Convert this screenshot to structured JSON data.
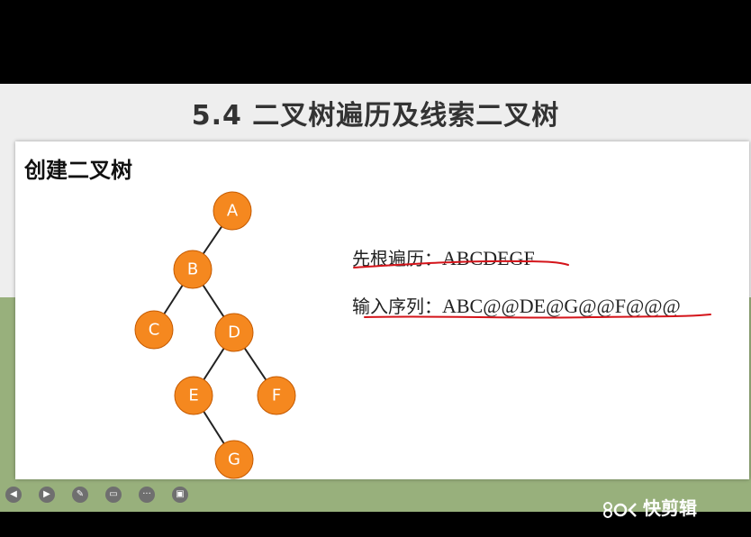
{
  "slide": {
    "title": "5.4 二叉树遍历及线索二叉树",
    "section_heading": "创建二叉树"
  },
  "tree": {
    "nodes": [
      "A",
      "B",
      "C",
      "D",
      "E",
      "F",
      "G"
    ],
    "edges": [
      [
        "A",
        "B"
      ],
      [
        "B",
        "C"
      ],
      [
        "B",
        "D"
      ],
      [
        "D",
        "E"
      ],
      [
        "D",
        "F"
      ],
      [
        "E",
        "G"
      ]
    ]
  },
  "sequences": {
    "preorder_label": "先根遍历：",
    "preorder_value": "ABCDEGF",
    "input_label": "输入序列：",
    "input_value": "ABC@@DE@G@@F@@@"
  },
  "toolbar": {
    "prev_icon": "prev-icon",
    "next_icon": "next-icon",
    "pen_icon": "pen-icon",
    "eraser_icon": "eraser-icon",
    "more_icon": "more-icon",
    "screen_icon": "screen-icon"
  },
  "watermark": {
    "text": "快剪辑"
  },
  "colors": {
    "node_fill": "#f5881f",
    "annotation_red": "#d4141a",
    "slide_background": "#eeeeee",
    "footer_green": "#98b07c"
  }
}
